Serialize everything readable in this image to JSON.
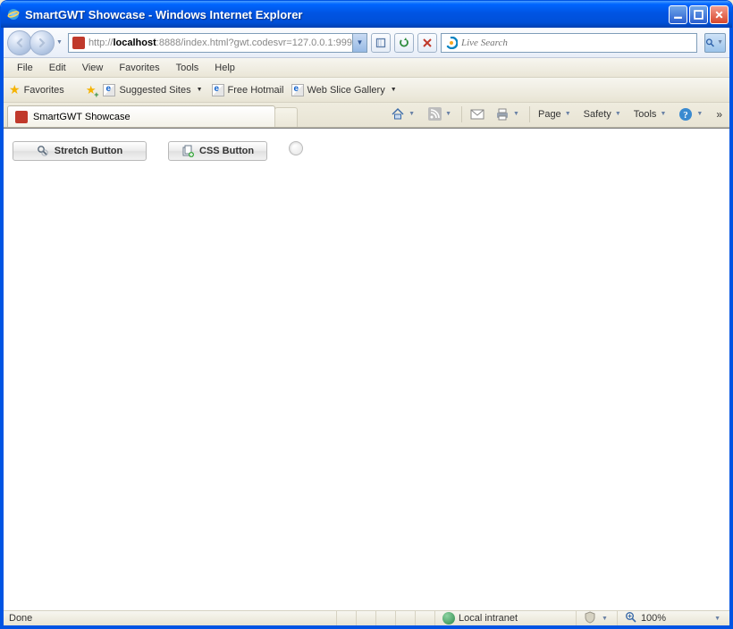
{
  "window": {
    "title": "SmartGWT Showcase - Windows Internet Explorer"
  },
  "nav": {
    "url_protocol": "http://",
    "url_host": "localhost",
    "url_rest": ":8888/index.html?gwt.codesvr=127.0.0.1:999",
    "search_placeholder": "Live Search"
  },
  "menu": {
    "file": "File",
    "edit": "Edit",
    "view": "View",
    "favorites": "Favorites",
    "tools": "Tools",
    "help": "Help"
  },
  "linksbar": {
    "favorites": "Favorites",
    "suggested": "Suggested Sites",
    "hotmail": "Free Hotmail",
    "webslice": "Web Slice Gallery"
  },
  "tab": {
    "title": "SmartGWT Showcase"
  },
  "cmdbar": {
    "page": "Page",
    "safety": "Safety",
    "tools": "Tools"
  },
  "content": {
    "stretch_btn": "Stretch Button",
    "css_btn": "CSS Button"
  },
  "status": {
    "done": "Done",
    "zone": "Local intranet",
    "zoom": "100%"
  }
}
